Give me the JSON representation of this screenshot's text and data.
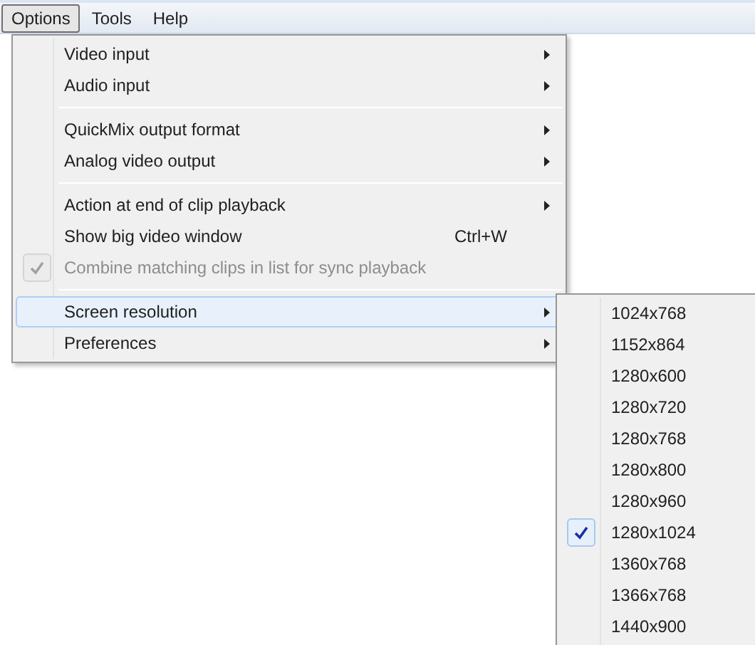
{
  "menubar": [
    {
      "label": "Options",
      "selected": true
    },
    {
      "label": "Tools",
      "selected": false
    },
    {
      "label": "Help",
      "selected": false
    }
  ],
  "menu": {
    "groups": [
      {
        "items": [
          {
            "label": "Video input",
            "submenu": true,
            "checked": false,
            "disabled": false,
            "highlighted": false
          },
          {
            "label": "Audio input",
            "submenu": true,
            "checked": false,
            "disabled": false,
            "highlighted": false
          }
        ]
      },
      {
        "items": [
          {
            "label": "QuickMix output format",
            "submenu": true,
            "checked": false,
            "disabled": false,
            "highlighted": false
          },
          {
            "label": "Analog video output",
            "submenu": true,
            "checked": false,
            "disabled": false,
            "highlighted": false
          }
        ]
      },
      {
        "items": [
          {
            "label": "Action at end of clip playback",
            "submenu": true,
            "checked": false,
            "disabled": false,
            "highlighted": false
          },
          {
            "label": "Show big video window",
            "shortcut": "Ctrl+W",
            "submenu": false,
            "checked": false,
            "disabled": false,
            "highlighted": false
          },
          {
            "label": "Combine matching clips in list for sync playback",
            "submenu": false,
            "checked": true,
            "disabled": true,
            "highlighted": false
          }
        ]
      },
      {
        "items": [
          {
            "label": "Screen resolution",
            "submenu": true,
            "checked": false,
            "disabled": false,
            "highlighted": true
          },
          {
            "label": "Preferences",
            "submenu": true,
            "checked": false,
            "disabled": false,
            "highlighted": false
          }
        ]
      }
    ]
  },
  "submenu": {
    "items": [
      {
        "label": "1024x768",
        "checked": false
      },
      {
        "label": "1152x864",
        "checked": false
      },
      {
        "label": "1280x600",
        "checked": false
      },
      {
        "label": "1280x720",
        "checked": false
      },
      {
        "label": "1280x768",
        "checked": false
      },
      {
        "label": "1280x800",
        "checked": false
      },
      {
        "label": "1280x960",
        "checked": false
      },
      {
        "label": "1280x1024",
        "checked": true
      },
      {
        "label": "1360x768",
        "checked": false
      },
      {
        "label": "1366x768",
        "checked": false
      },
      {
        "label": "1440x900",
        "checked": false
      }
    ]
  }
}
